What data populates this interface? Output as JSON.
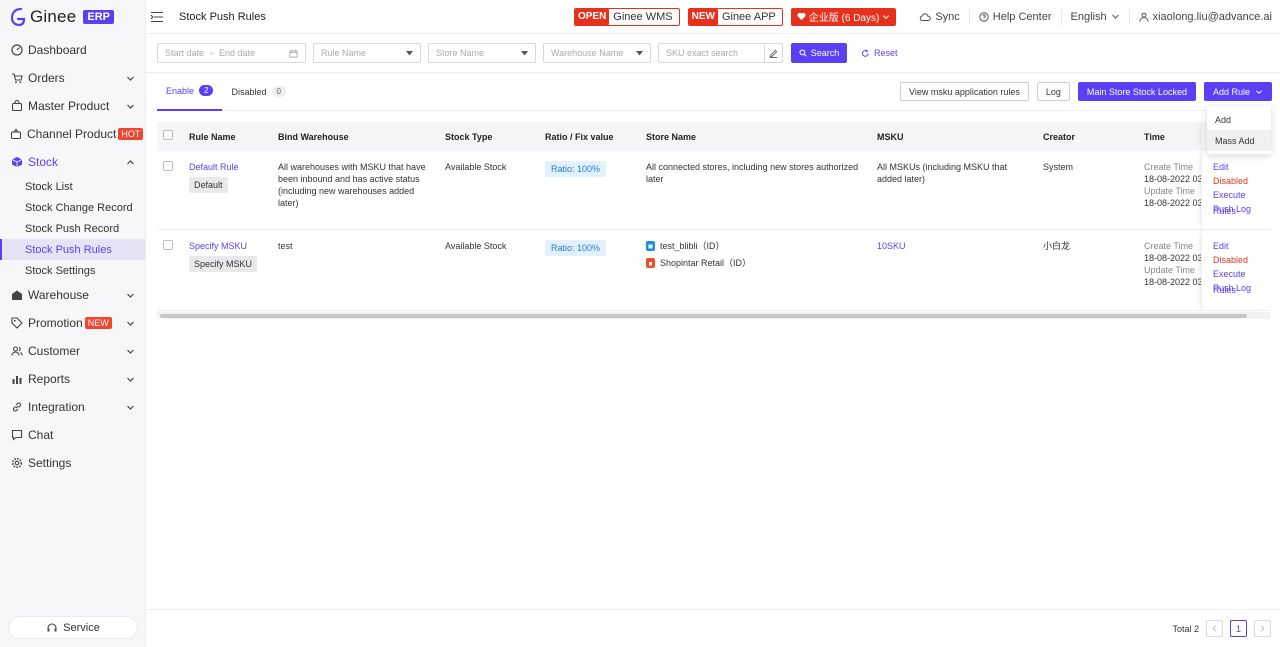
{
  "brand": {
    "name": "Ginee",
    "badge": "ERP"
  },
  "sidebar": {
    "items": [
      {
        "label": "Dashboard",
        "icon": "dashboard-icon"
      },
      {
        "label": "Orders",
        "icon": "cart-icon"
      },
      {
        "label": "Master Product",
        "icon": "bag-icon"
      },
      {
        "label": "Channel Product",
        "icon": "channel-icon",
        "badge": "HOT"
      },
      {
        "label": "Stock",
        "icon": "cube-icon"
      },
      {
        "label": "Warehouse",
        "icon": "warehouse-icon"
      },
      {
        "label": "Promotion",
        "icon": "tag-icon",
        "badge": "NEW"
      },
      {
        "label": "Customer",
        "icon": "users-icon"
      },
      {
        "label": "Reports",
        "icon": "chart-icon"
      },
      {
        "label": "Integration",
        "icon": "link-icon"
      },
      {
        "label": "Chat",
        "icon": "chat-icon"
      },
      {
        "label": "Settings",
        "icon": "gear-icon"
      }
    ],
    "stock_sub": [
      "Stock List",
      "Stock Change Record",
      "Stock Push Record",
      "Stock Push Rules",
      "Stock Settings"
    ],
    "service_label": "Service"
  },
  "topbar": {
    "title": "Stock Push Rules",
    "wms_tag": "OPEN",
    "wms_label": "Ginee WMS",
    "app_tag": "NEW",
    "app_label": "Ginee APP",
    "enterprise_label": "企业版 (6 Days)",
    "sync": "Sync",
    "help": "Help Center",
    "language": "English",
    "user": "xiaolong.liu@advance.ai"
  },
  "filters": {
    "start_date": "Start date",
    "date_sep": "-",
    "end_date": "End date",
    "rule_name": "Rule Name",
    "store_name": "Store Name",
    "warehouse_name": "Warehouse Name",
    "sku_placeholder": "SKU exact search",
    "search": "Search",
    "reset": "Reset"
  },
  "tabs": [
    {
      "label": "Enable",
      "count": "2"
    },
    {
      "label": "Disabled",
      "count": "0"
    }
  ],
  "actions": {
    "view_rules": "View msku application rules",
    "log": "Log",
    "locked": "Main Store Stock Locked",
    "add_rule": "Add Rule",
    "menu": [
      "Add",
      "Mass Add"
    ]
  },
  "table": {
    "headers": [
      "Rule Name",
      "Bind Warehouse",
      "Stock Type",
      "Ratio / Fix value",
      "Store Name",
      "MSKU",
      "Creator",
      "Time"
    ],
    "rows": [
      {
        "name": "Default Rule",
        "tag": "Default",
        "warehouse": "All warehouses with MSKU that have been inbound and has active status (including new warehouses added later)",
        "stock_type": "Available Stock",
        "ratio": "Ratio: 100%",
        "store": "All connected stores, including new stores authorized later",
        "msku": "All MSKUs (including MSKU that added later)",
        "creator": "System",
        "create_label": "Create Time",
        "create_time": "18-08-2022 03",
        "update_label": "Update Time",
        "update_time": "18-08-2022 03",
        "ops": [
          "Edit",
          "Disabled",
          "Execute Rules",
          "Push Log"
        ]
      },
      {
        "name": "Specify MSKU",
        "tag": "Specify MSKU",
        "warehouse": "test",
        "stock_type": "Available Stock",
        "ratio": "Ratio: 100%",
        "stores": [
          "test_blibli（ID）",
          "Shopintar Retail（ID）"
        ],
        "msku": "10SKU",
        "creator": "小白龙",
        "create_label": "Create Time",
        "create_time": "18-08-2022 03",
        "update_label": "Update Time",
        "update_time": "18-08-2022 03",
        "ops": [
          "Edit",
          "Disabled",
          "Execute Rules",
          "Push Log"
        ]
      }
    ]
  },
  "footer": {
    "total": "Total 2",
    "page": "1"
  },
  "colors": {
    "accent": "#5b3ff5",
    "danger": "#e6321c",
    "ratio_bg": "#e3f1fc"
  }
}
